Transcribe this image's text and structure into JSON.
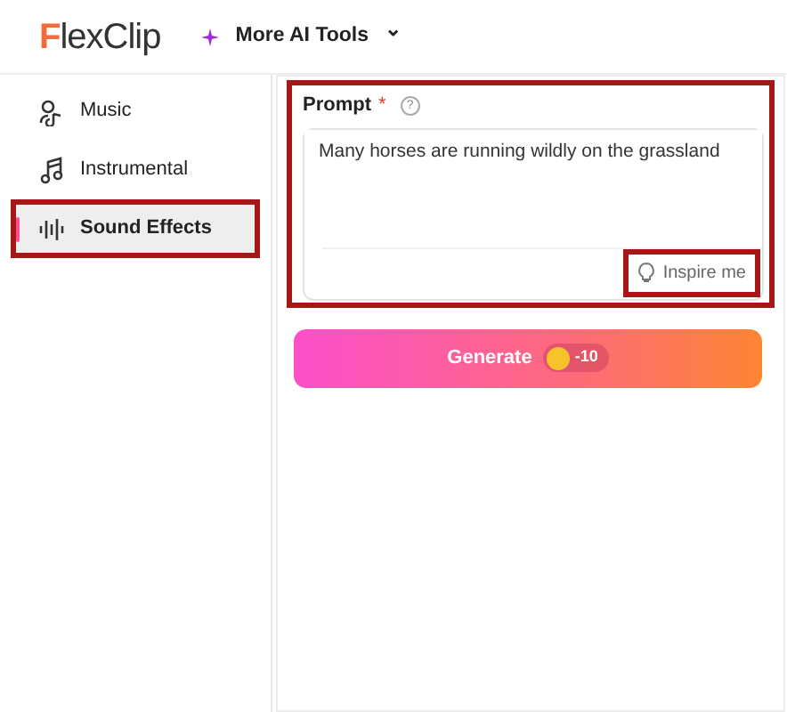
{
  "header": {
    "logo": "FlexClip",
    "menu": {
      "label": "More AI Tools",
      "caret": "⌄"
    }
  },
  "sidebar": {
    "items": [
      {
        "kind": "music",
        "label": "Music",
        "selected": false,
        "highlighted": false
      },
      {
        "kind": "instrumental",
        "label": "Instrumental",
        "selected": false,
        "highlighted": false
      },
      {
        "kind": "sound",
        "label": "Sound Effects",
        "selected": true,
        "highlighted": true
      }
    ]
  },
  "prompt": {
    "label": "Prompt",
    "required": "*",
    "help": "?",
    "value": "Many horses are running wildly on the grassland",
    "highlighted": true,
    "inspire": {
      "label": "Inspire me",
      "highlighted": true
    }
  },
  "generate": {
    "label": "Generate",
    "cost": "-10"
  }
}
